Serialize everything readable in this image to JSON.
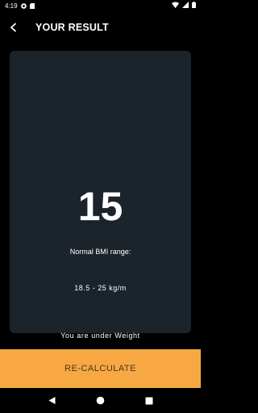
{
  "status_bar": {
    "time": "4:19",
    "icons_left": [
      "pocket-casts-icon",
      "sd-card-icon"
    ],
    "icons_right": [
      "wifi-icon",
      "cell-signal-icon",
      "battery-icon"
    ]
  },
  "app_bar": {
    "back_icon": "chevron-left-icon",
    "title": "YOUR RESULT"
  },
  "result": {
    "bmi": "15",
    "range_title": "Normal BMI range:",
    "range_value": "18.5 - 25 kg/m",
    "status": "You are under Weight"
  },
  "action": {
    "recalculate_label": "RE-CALCULATE"
  },
  "nav_bar": {
    "buttons": [
      "back-triangle-icon",
      "home-circle-icon",
      "recents-square-icon"
    ]
  },
  "colors": {
    "background": "#000000",
    "card": "#1b232b",
    "accent": "#f7a843",
    "text": "#ffffff"
  }
}
